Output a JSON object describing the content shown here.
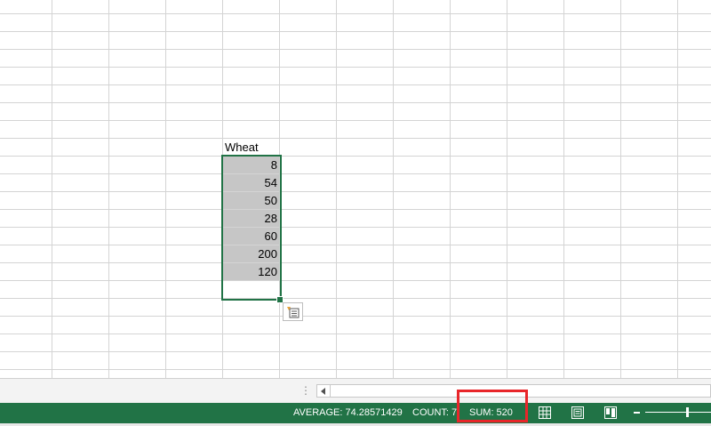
{
  "sheet": {
    "header": "Wheat",
    "values": [
      "8",
      "54",
      "50",
      "28",
      "60",
      "200",
      "120"
    ]
  },
  "status": {
    "average": "AVERAGE: 74.28571429",
    "count": "COUNT: 7",
    "sum": "SUM: 520"
  },
  "colors": {
    "accent": "#217346",
    "highlight": "#e8262a",
    "selected_fill": "#c6c6c6"
  },
  "icons": {
    "quick_analysis": "quick-analysis-icon",
    "normal_view": "normal-view-icon",
    "page_layout": "page-layout-icon",
    "page_break": "page-break-preview-icon"
  }
}
